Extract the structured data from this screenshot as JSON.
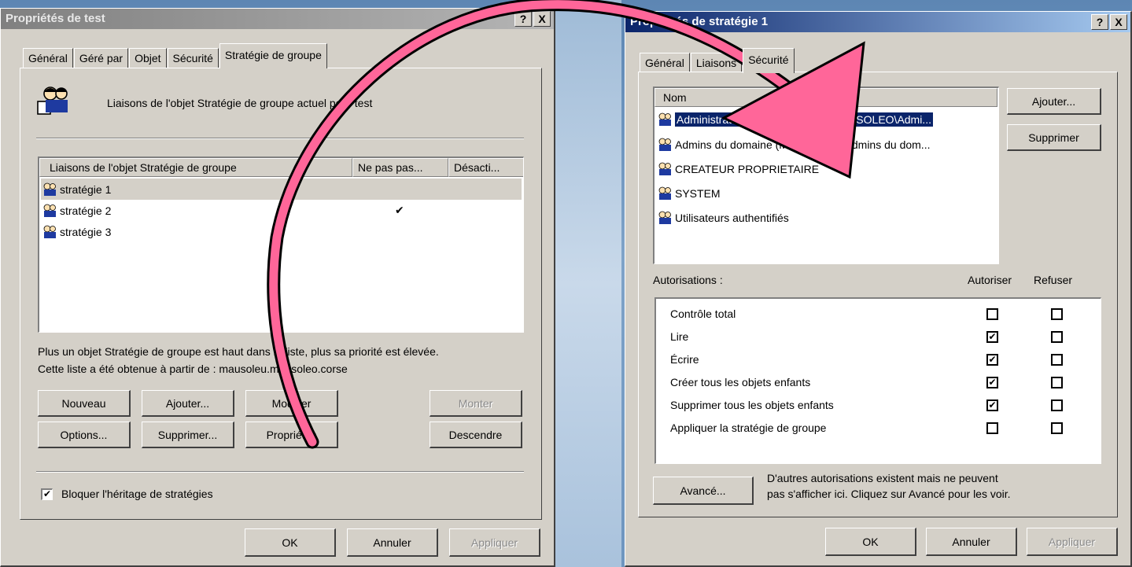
{
  "left_dialog": {
    "title": "Propriétés de test",
    "tabs": [
      "Général",
      "Géré par",
      "Objet",
      "Sécurité",
      "Stratégie de groupe"
    ],
    "header_text": "Liaisons de l'objet Stratégie de groupe actuel pour test",
    "columns": [
      "Liaisons de l'objet Stratégie de groupe",
      "Ne pas pas...",
      "Désacti..."
    ],
    "rows": [
      {
        "name": "stratégie 1",
        "check": ""
      },
      {
        "name": "stratégie 2",
        "check": "✔"
      },
      {
        "name": "stratégie 3",
        "check": ""
      }
    ],
    "info_line1": "Plus un objet Stratégie de groupe est haut dans la liste, plus sa priorité est élevée.",
    "info_line2": "Cette liste a été obtenue à partir de : mausoleu.mausoleo.corse",
    "buttons": {
      "nouveau": "Nouveau",
      "ajouter": "Ajouter...",
      "modifier": "Modifier",
      "monter": "Monter",
      "options": "Options...",
      "supprimer": "Supprimer...",
      "proprietes": "Propriétés",
      "descendre": "Descendre",
      "ok": "OK",
      "annuler": "Annuler",
      "appliquer": "Appliquer"
    },
    "block_inheritance": "Bloquer l'héritage de stratégies",
    "block_checked": "✔",
    "help": "?",
    "close": "X"
  },
  "right_dialog": {
    "title": "Propriétés de stratégie 1",
    "tabs": [
      "Général",
      "Liaisons",
      "Sécurité"
    ],
    "name_header": "Nom",
    "names": [
      "Administrateurs de l'entreprise (MAUSOLEO\\Admi...",
      "Admins du domaine (MAUSOLEO\\Admins du dom...",
      "CREATEUR PROPRIETAIRE",
      "SYSTEM",
      "Utilisateurs authentifiés"
    ],
    "buttons": {
      "ajouter": "Ajouter...",
      "supprimer": "Supprimer",
      "avance": "Avancé...",
      "ok": "OK",
      "annuler": "Annuler",
      "appliquer": "Appliquer"
    },
    "permissions_label": "Autorisations :",
    "allow_label": "Autoriser",
    "deny_label": "Refuser",
    "permissions": [
      {
        "name": "Contrôle total",
        "allow": "",
        "deny": ""
      },
      {
        "name": "Lire",
        "allow": "✔",
        "deny": ""
      },
      {
        "name": "Écrire",
        "allow": "✔",
        "deny": ""
      },
      {
        "name": "Créer tous les objets enfants",
        "allow": "✔",
        "deny": ""
      },
      {
        "name": "Supprimer tous les objets enfants",
        "allow": "✔",
        "deny": ""
      },
      {
        "name": "Appliquer la stratégie de groupe",
        "allow": "",
        "deny": ""
      }
    ],
    "advanced_note_1": "D'autres autorisations existent mais ne peuvent",
    "advanced_note_2": "pas s'afficher ici. Cliquez sur Avancé pour les voir.",
    "help": "?",
    "close": "X"
  },
  "colors": {
    "arrow": "#ff6699",
    "arrow_outline": "#000000",
    "selection": "#0a246a",
    "face": "#d4d0c8"
  }
}
